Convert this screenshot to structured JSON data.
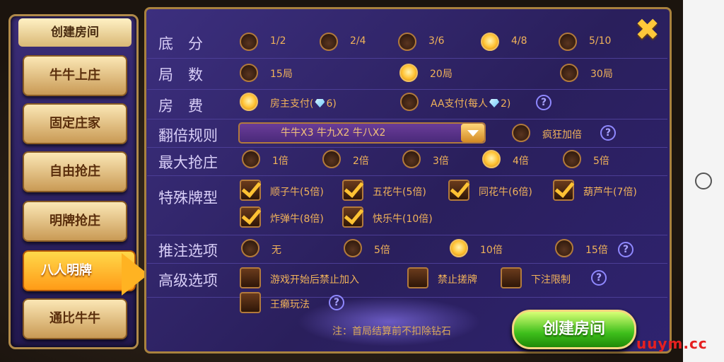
{
  "left_menu": {
    "title": "创建房间",
    "items": [
      {
        "label": "牛牛上庄"
      },
      {
        "label": "固定庄家"
      },
      {
        "label": "自由抢庄"
      },
      {
        "label": "明牌抢庄"
      },
      {
        "label": "八人明牌",
        "active": true
      },
      {
        "label": "通比牛牛"
      }
    ]
  },
  "rows": {
    "base_score": {
      "label": "底　分",
      "options": [
        "1/2",
        "2/4",
        "3/6",
        "4/8",
        "5/10"
      ],
      "selected": "4/8"
    },
    "rounds": {
      "label": "局　数",
      "options": [
        "15局",
        "20局",
        "30局"
      ],
      "selected": "20局"
    },
    "room_fee": {
      "label": "房　费",
      "options": [
        "房主支付(",
        "6)",
        "AA支付(每人",
        "2)"
      ],
      "selected": "房主支付"
    },
    "multiplier": {
      "label": "翻倍规则",
      "dropdown_value": "牛牛X3  牛九X2  牛八X2",
      "extra_option": "疯狂加倍"
    },
    "max_grab": {
      "label": "最大抢庄",
      "options": [
        "1倍",
        "2倍",
        "3倍",
        "4倍",
        "5倍"
      ],
      "selected": "4倍"
    },
    "special": {
      "label": "特殊牌型",
      "options": [
        "顺子牛(5倍)",
        "五花牛(5倍)",
        "同花牛(6倍)",
        "葫芦牛(7倍)",
        "炸弹牛(8倍)",
        "快乐牛(10倍)"
      ]
    },
    "push_bet": {
      "label": "推注选项",
      "options": [
        "无",
        "5倍",
        "10倍",
        "15倍"
      ],
      "selected": "10倍"
    },
    "advanced": {
      "label": "高级选项",
      "options": [
        "游戏开始后禁止加入",
        "禁止搓牌",
        "下注限制",
        "王癞玩法"
      ]
    }
  },
  "help_glyph": "?",
  "close_glyph": "✖",
  "note": "注：首局结算前不扣除钻石",
  "create_button": "创建房间",
  "watermark": "uuym.cc",
  "colors": {
    "accent": "#ffc233",
    "panel": "#2a1f5c",
    "create": "#3fbf1c"
  }
}
